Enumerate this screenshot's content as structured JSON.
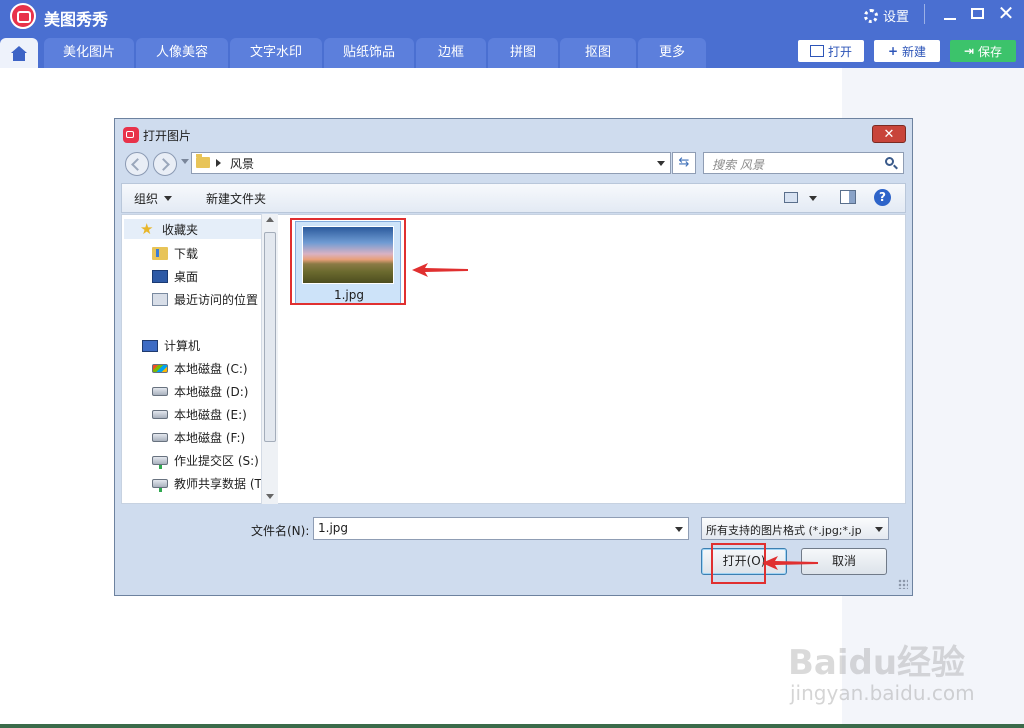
{
  "app": {
    "title": "美图秀秀",
    "settings_label": "设置"
  },
  "nav_tabs": [
    "美化图片",
    "人像美容",
    "文字水印",
    "贴纸饰品",
    "边框",
    "拼图",
    "抠图",
    "更多"
  ],
  "toolbar_actions": {
    "open": "打开",
    "new": "新建",
    "save": "保存"
  },
  "dialog": {
    "title": "打开图片",
    "address": "风景",
    "search_placeholder": "搜索 风景",
    "toolbar": {
      "organize": "组织",
      "new_folder": "新建文件夹"
    },
    "sidebar": {
      "favorites": {
        "label": "收藏夹",
        "items": [
          "下载",
          "桌面",
          "最近访问的位置"
        ]
      },
      "computer": {
        "label": "计算机",
        "items": [
          "本地磁盘 (C:)",
          "本地磁盘 (D:)",
          "本地磁盘 (E:)",
          "本地磁盘 (F:)",
          "作业提交区 (S:)",
          "教师共享数据 (T:"
        ]
      }
    },
    "files": [
      {
        "name": "1.jpg"
      }
    ],
    "filename_label": "文件名(N):",
    "filename_value": "1.jpg",
    "filetype_value": "所有支持的图片格式 (*.jpg;*.jp",
    "open_button": "打开(O)",
    "cancel_button": "取消"
  },
  "watermark": {
    "brand": "Baidu经验",
    "url": "jingyan.baidu.com"
  },
  "colors": {
    "titlebar": "#4a6fd1",
    "tab": "#5c7fdc",
    "save": "#3cc36b",
    "highlight": "#e03030"
  }
}
